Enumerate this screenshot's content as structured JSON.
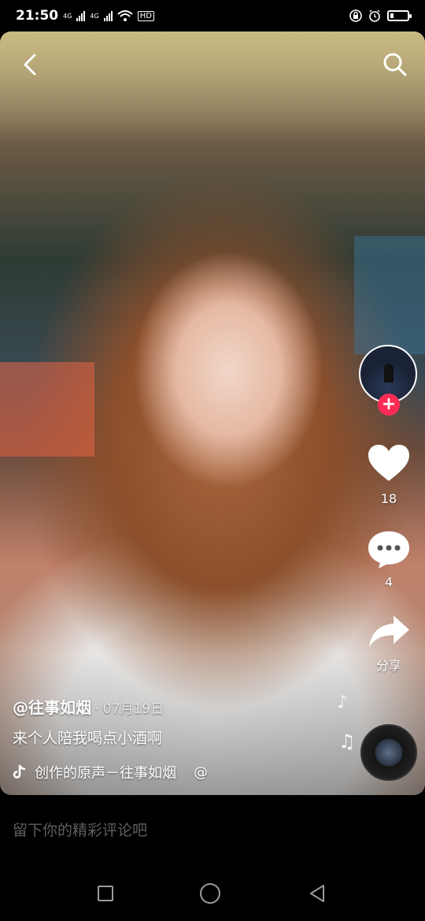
{
  "status_bar": {
    "time": "21:50",
    "net1": "4G",
    "net2": "4G",
    "hd": "HD",
    "battery_level": 0.2
  },
  "video": {
    "icons": [
      "back-arrow-icon",
      "search-icon"
    ]
  },
  "actions": {
    "like_count": "18",
    "comment_count": "4",
    "share_label": "分享",
    "follow_symbol": "+"
  },
  "caption": {
    "author": "@往事如烟",
    "date": "· 07月19日",
    "text": "来个人陪我喝点小酒啊",
    "music": "创作的原声－往事如烟",
    "music_at": "@"
  },
  "comment_bar": {
    "placeholder": "留下你的精彩评论吧"
  },
  "colors": {
    "follow": "#fe2c55",
    "placeholder": "#5e5e5e"
  }
}
